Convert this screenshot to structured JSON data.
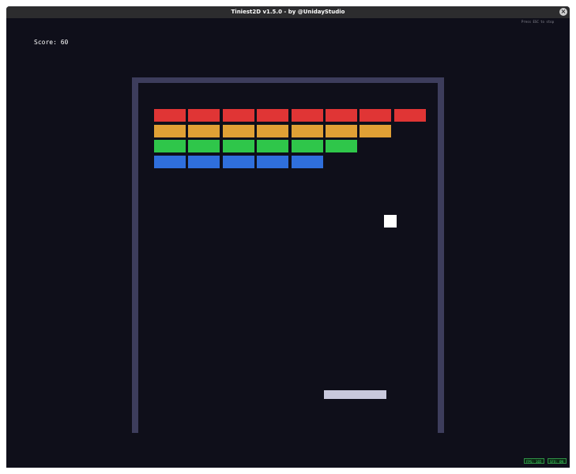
{
  "window": {
    "title": "Tiniest2D v1.5.0 - by @UnidayStudio",
    "close_glyph": "×"
  },
  "hud": {
    "hint": "Press ESC to stop",
    "score_text": "Score: 60",
    "fps_badge": "FPS: 165",
    "sfx_badge": "SFX: ON"
  },
  "colors": {
    "background": "#0f0f1a",
    "titlebar": "#2c2c2e",
    "walls": "#3d3d5c",
    "paddle": "#c9c9dc",
    "ball": "#ffffff",
    "brick_rows": [
      "#e03535",
      "#e0a035",
      "#2fc64a",
      "#2f6fdc"
    ]
  },
  "bricks": {
    "row_counts": [
      8,
      7,
      6,
      5
    ]
  }
}
